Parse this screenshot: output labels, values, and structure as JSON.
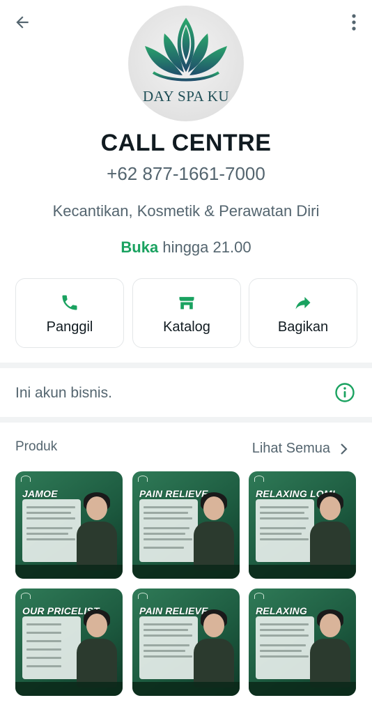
{
  "header": {
    "back_icon": "arrow-left-icon",
    "menu_icon": "more-vertical-icon"
  },
  "profile": {
    "avatar_brand": "DAY SPA KU",
    "name": "CALL CENTRE",
    "phone": "+62 877-1661-7000",
    "category": "Kecantikan, Kosmetik & Perawatan Diri",
    "hours_status": "Buka",
    "hours_text": " hingga 21.00",
    "colors": {
      "accent_green": "#1aa260",
      "text_secondary": "#54656f"
    }
  },
  "actions": [
    {
      "label": "Panggil",
      "icon": "phone-icon"
    },
    {
      "label": "Katalog",
      "icon": "store-icon"
    },
    {
      "label": "Bagikan",
      "icon": "share-icon"
    }
  ],
  "business": {
    "text": "Ini akun bisnis.",
    "icon": "info-icon"
  },
  "products": {
    "title": "Produk",
    "see_all": "Lihat Semua",
    "items": [
      {
        "title": "JAMOE"
      },
      {
        "title": "PAIN RELIEVE"
      },
      {
        "title": "RELAXING LOMI"
      },
      {
        "title": "OUR PRICELIST"
      },
      {
        "title": "PAIN RELIEVE"
      },
      {
        "title": "RELAXING"
      }
    ]
  }
}
